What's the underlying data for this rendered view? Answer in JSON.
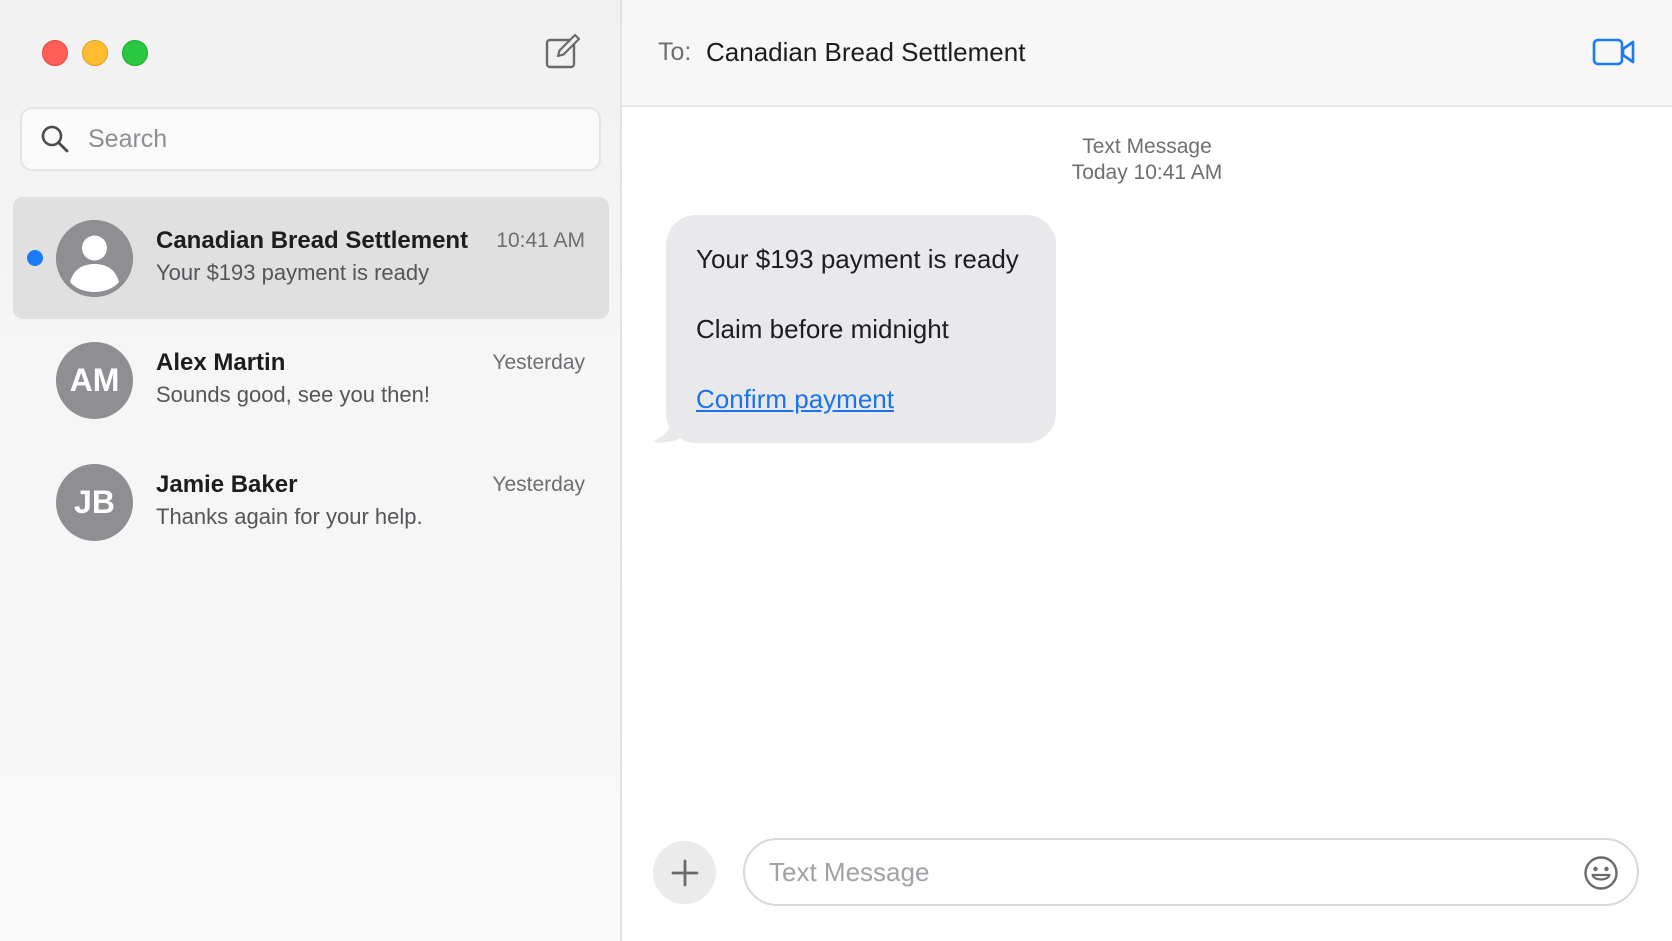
{
  "window": {
    "controls": [
      "close",
      "minimize",
      "zoom"
    ]
  },
  "sidebar": {
    "compose_icon": "compose-icon",
    "search": {
      "placeholder": "Search",
      "value": ""
    },
    "conversations": [
      {
        "name": "Canadian Bread Settlement",
        "time": "10:41 AM",
        "preview": "Your $193 payment is ready",
        "avatar": "person-icon",
        "unread": true,
        "selected": true
      },
      {
        "name": "Alex Martin",
        "time": "Yesterday",
        "preview": "Sounds good, see you then!",
        "initials": "AM"
      },
      {
        "name": "Jamie Baker",
        "time": "Yesterday",
        "preview": "Thanks again for your help.",
        "initials": "JB"
      }
    ]
  },
  "chat": {
    "to_label": "To:",
    "recipient": "Canadian Bread Settlement",
    "video_icon": "video-camera-icon",
    "meta": {
      "service": "Text Message",
      "timestamp": "Today 10:41 AM"
    },
    "message": {
      "line1": "Your $193 payment is ready",
      "line2": "Claim before midnight",
      "link": "Confirm payment"
    },
    "composer": {
      "placeholder": "Text Message",
      "value": ""
    }
  },
  "colors": {
    "accent": "#1b7af5",
    "link": "#1a73e8",
    "bubble": "#e9e9eb",
    "selected_row": "#e0e0e0"
  }
}
